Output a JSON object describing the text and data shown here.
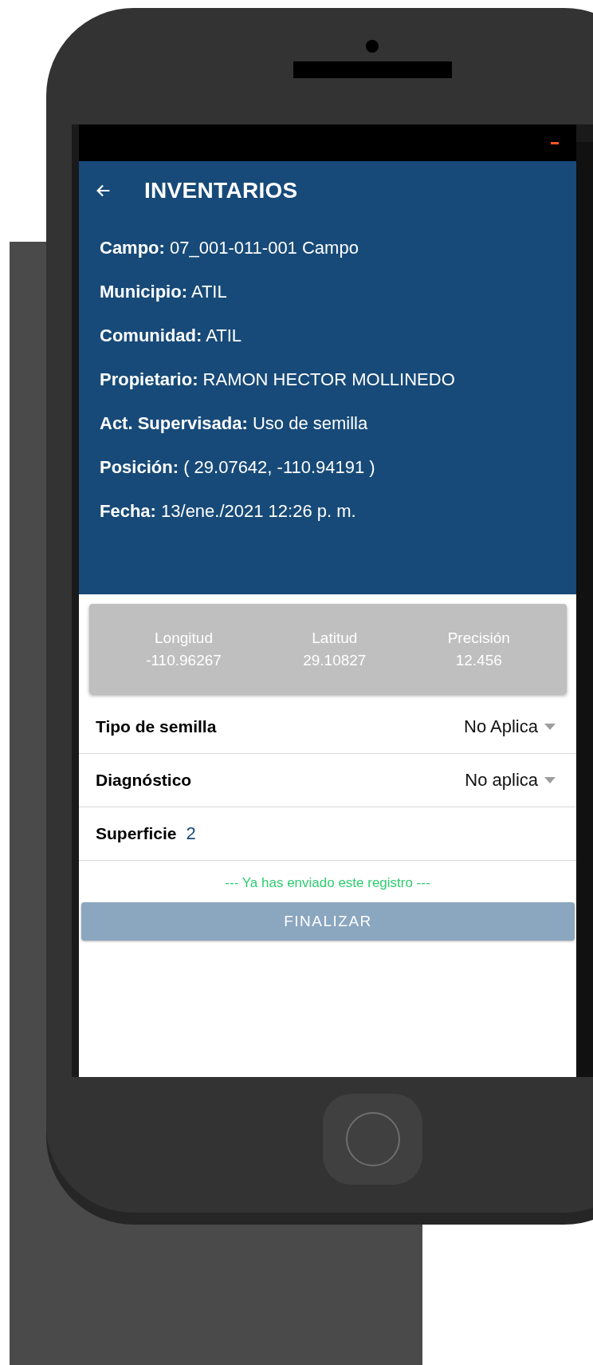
{
  "app_bar": {
    "title": "INVENTARIOS"
  },
  "details": [
    {
      "label": "Campo:",
      "value": "07_001-011-001 Campo"
    },
    {
      "label": "Municipio:",
      "value": "ATIL"
    },
    {
      "label": "Comunidad:",
      "value": "ATIL"
    },
    {
      "label": "Propietario:",
      "value": "RAMON HECTOR MOLLINEDO"
    },
    {
      "label": "Act. Supervisada:",
      "value": "Uso de semilla"
    },
    {
      "label": "Posición:",
      "value": "( 29.07642, -110.94191 )"
    },
    {
      "label": "Fecha:",
      "value": "13/ene./2021 12:26 p. m."
    }
  ],
  "coordinates": [
    {
      "label": "Longitud",
      "value": "-110.96267"
    },
    {
      "label": "Latitud",
      "value": "29.10827"
    },
    {
      "label": "Precisión",
      "value": "12.456"
    }
  ],
  "form": [
    {
      "kind": "select",
      "label": "Tipo de semilla",
      "value": "No Aplica"
    },
    {
      "kind": "select",
      "label": "Diagnóstico",
      "value": "No aplica"
    },
    {
      "kind": "number",
      "label": "Superficie",
      "value": "2"
    }
  ],
  "message": "--- Ya has enviado este registro ---",
  "button": {
    "label": "FINALIZAR",
    "disabled": true
  }
}
